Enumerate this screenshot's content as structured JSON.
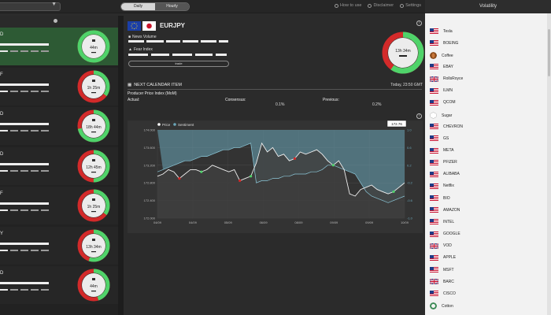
{
  "topbar": {
    "toggle": [
      "Daily",
      "Hourly"
    ],
    "links": [
      "How to use",
      "Disclaimer",
      "Settings"
    ]
  },
  "pairs": [
    {
      "name": "D",
      "time": "44m",
      "active": true,
      "green_frac": 1.0
    },
    {
      "name": "F",
      "time": "1h 25m",
      "active": false,
      "green_frac": 0.35
    },
    {
      "name": "D",
      "time": "18h 44m",
      "active": false,
      "green_frac": 0.72
    },
    {
      "name": "D",
      "time": "12h 45m",
      "active": false,
      "green_frac": 0.5
    },
    {
      "name": "F",
      "time": "1h 25m",
      "active": false,
      "green_frac": 0.35
    },
    {
      "name": "Y",
      "time": "13h 34m",
      "active": false,
      "green_frac": 0.55
    },
    {
      "name": "D",
      "time": "44m",
      "active": false,
      "green_frac": 0.45
    }
  ],
  "main": {
    "pair": "EURJPY",
    "news_volume_label": "News Volume",
    "fear_index_label": "Fear Index",
    "trade_label": "trade",
    "ring_time": "13h 34m",
    "ring_green_frac": 0.6
  },
  "calendar": {
    "title": "NEXT CALENDAR ITEM",
    "time": "Today, 23:50 GMT",
    "event": "Producer Price Index (MoM)",
    "actual_label": "Actual:",
    "consensus_label": "Consensus:",
    "previous_label": "Previous:",
    "consensus_value": "0.1%",
    "previous_value": "0.2%"
  },
  "chart_data": {
    "type": "line",
    "legend": [
      "Price",
      "Sentiment"
    ],
    "price_label": "172.76",
    "x_ticks": [
      "04/09",
      "04/09",
      "05/09",
      "06/09",
      "08/09",
      "09/09",
      "09/09",
      "10/09"
    ],
    "y_left_ticks": [
      "174.000",
      "173.600",
      "173.200",
      "172.800",
      "172.400",
      "172.000"
    ],
    "y_right_ticks": [
      "1.0",
      "0.6",
      "0.2",
      "-0.2",
      "-0.6",
      "-1.0"
    ],
    "ylim": [
      172.0,
      174.0
    ],
    "sentiment_ylim": [
      -1.0,
      1.0
    ],
    "price": [
      172.95,
      173.0,
      173.1,
      173.05,
      172.9,
      173.0,
      173.1,
      173.1,
      173.05,
      173.1,
      173.2,
      173.15,
      173.1,
      173.05,
      173.1,
      172.85,
      172.9,
      172.95,
      173.25,
      173.7,
      173.5,
      173.6,
      173.4,
      173.45,
      173.3,
      173.35,
      173.5,
      173.45,
      173.5,
      173.55,
      173.45,
      173.3,
      173.2,
      173.3,
      173.1,
      172.55,
      172.5,
      172.65,
      172.7,
      172.75,
      172.65,
      172.6,
      172.55,
      172.6,
      172.7,
      172.8
    ],
    "sentiment": [
      0.05,
      0.1,
      0.15,
      0.2,
      0.25,
      0.3,
      0.3,
      0.35,
      0.4,
      0.4,
      0.45,
      0.5,
      0.55,
      0.55,
      0.6,
      0.6,
      0.65,
      0.7,
      -0.2,
      -0.15,
      -0.15,
      -0.1,
      -0.1,
      -0.05,
      -0.05,
      0.0,
      0.0,
      0.0,
      0.05,
      0.05,
      0.1,
      0.2,
      0.2,
      0.15,
      0.1,
      0.05,
      0.0,
      -0.2,
      -0.4,
      -0.5,
      -0.55,
      -0.6,
      -0.65,
      -0.6,
      -0.55,
      -0.5
    ],
    "red_markers": [
      4,
      15,
      25
    ],
    "green_markers": [
      8,
      17,
      32,
      43
    ]
  },
  "volatility": {
    "title": "Volatility",
    "items": [
      {
        "label": "Tesla",
        "icon": "us-flag"
      },
      {
        "label": "BOEING",
        "icon": "us-flag"
      },
      {
        "label": "Coffee",
        "icon": "coffee-coin"
      },
      {
        "label": "EBAY",
        "icon": "us-flag"
      },
      {
        "label": "RollsRoyce",
        "icon": "uk-flag"
      },
      {
        "label": "ILMN",
        "icon": "us-flag"
      },
      {
        "label": "QCOM",
        "icon": "us-flag"
      },
      {
        "label": "Sugar",
        "icon": "sugar-cube"
      },
      {
        "label": "CHEVRON",
        "icon": "us-flag"
      },
      {
        "label": "GS",
        "icon": "us-flag"
      },
      {
        "label": "META",
        "icon": "us-flag"
      },
      {
        "label": "PFIZER",
        "icon": "us-flag"
      },
      {
        "label": "ALIBABA",
        "icon": "us-flag"
      },
      {
        "label": "Netflix",
        "icon": "us-flag"
      },
      {
        "label": "BIO",
        "icon": "us-flag"
      },
      {
        "label": "AMAZON",
        "icon": "us-flag"
      },
      {
        "label": "INTEL",
        "icon": "us-flag"
      },
      {
        "label": "GOOGLE",
        "icon": "us-flag"
      },
      {
        "label": "VOD",
        "icon": "uk-flag"
      },
      {
        "label": "APPLE",
        "icon": "us-flag"
      },
      {
        "label": "MSFT",
        "icon": "us-flag"
      },
      {
        "label": "BARC",
        "icon": "uk-flag"
      },
      {
        "label": "CISCO",
        "icon": "us-flag"
      },
      {
        "label": "Cotton",
        "icon": "cotton-ball"
      }
    ]
  },
  "colors": {
    "green": "#4fd36a",
    "red": "#d32a2a",
    "active_card": "#2d5a34",
    "sentiment_fill": "#6aa6b8"
  }
}
